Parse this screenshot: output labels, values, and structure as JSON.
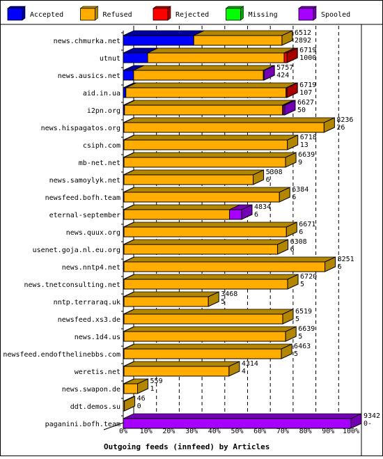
{
  "chart_data": {
    "type": "bar",
    "orientation": "horizontal",
    "stacked": true,
    "title": "Outgoing feeds (innfeed) by Articles",
    "xlabel": "Outgoing feeds (innfeed) by Articles",
    "ylabel": "",
    "xlim_percent": [
      0,
      100
    ],
    "scale_max_articles": 9342,
    "x_ticks": [
      "0%",
      "10%",
      "20%",
      "30%",
      "40%",
      "50%",
      "60%",
      "70%",
      "80%",
      "90%",
      "100%"
    ],
    "grid": "vertical dashed",
    "legend_position": "top",
    "legend": [
      {
        "name": "Accepted",
        "color": "#0000ff",
        "dark": "#00009c"
      },
      {
        "name": "Refused",
        "color": "#ffad00",
        "dark": "#b38600"
      },
      {
        "name": "Rejected",
        "color": "#ff0000",
        "dark": "#a80000"
      },
      {
        "name": "Missing",
        "color": "#00ff00",
        "dark": "#00a800"
      },
      {
        "name": "Spooled",
        "color": "#a600ff",
        "dark": "#7400b3"
      }
    ],
    "categories": [
      "news.chmurka.net",
      "utnut",
      "news.ausics.net",
      "aid.in.ua",
      "i2pn.org",
      "news.hispagatos.org",
      "csiph.com",
      "mb-net.net",
      "news.samoylyk.net",
      "newsfeed.bofh.team",
      "eternal-september",
      "news.quux.org",
      "usenet.goja.nl.eu.org",
      "news.nntp4.net",
      "news.tnetconsulting.net",
      "nntp.terraraq.uk",
      "newsfeed.xs3.de",
      "news.1d4.us",
      "newsfeed.endofthelinebbs.com",
      "weretis.net",
      "news.swapon.de",
      "ddt.demos.su",
      "paganini.bofh.team"
    ],
    "offered": [
      6512,
      6719,
      5757,
      6719,
      6627,
      8236,
      6718,
      6639,
      5308,
      6384,
      4834,
      6671,
      6308,
      8251,
      6720,
      3468,
      6519,
      6639,
      6463,
      4314,
      559,
      46,
      9342
    ],
    "accepted_label": [
      "2892",
      "1000",
      "424",
      "107",
      "50",
      "26",
      "13",
      "9",
      "6",
      "6",
      "6",
      "6",
      "6",
      "6",
      "5",
      "5",
      "5",
      "5",
      "5",
      "4",
      "1",
      "0",
      "0-"
    ],
    "series": [
      {
        "name": "Accepted",
        "values": [
          2892,
          1000,
          424,
          107,
          50,
          26,
          13,
          9,
          6,
          6,
          6,
          6,
          6,
          6,
          5,
          5,
          5,
          5,
          5,
          4,
          1,
          0,
          0
        ]
      },
      {
        "name": "Refused",
        "values": [
          3620,
          5599,
          5323,
          6572,
          6487,
          8210,
          6705,
          6630,
          5302,
          6378,
          4328,
          6665,
          6302,
          8245,
          6715,
          3463,
          6514,
          6634,
          6458,
          4310,
          558,
          46,
          0
        ]
      },
      {
        "name": "Rejected",
        "values": [
          0,
          120,
          0,
          40,
          30,
          0,
          0,
          0,
          0,
          0,
          0,
          0,
          0,
          0,
          0,
          0,
          0,
          0,
          0,
          0,
          0,
          0,
          0
        ]
      },
      {
        "name": "Missing",
        "values": [
          0,
          0,
          0,
          0,
          0,
          0,
          0,
          0,
          0,
          0,
          0,
          0,
          0,
          0,
          0,
          0,
          0,
          0,
          0,
          0,
          0,
          0,
          0
        ]
      },
      {
        "name": "Spooled",
        "values": [
          0,
          0,
          10,
          0,
          60,
          0,
          0,
          0,
          0,
          0,
          500,
          0,
          0,
          0,
          0,
          0,
          0,
          0,
          0,
          0,
          0,
          0,
          9342
        ]
      }
    ]
  }
}
